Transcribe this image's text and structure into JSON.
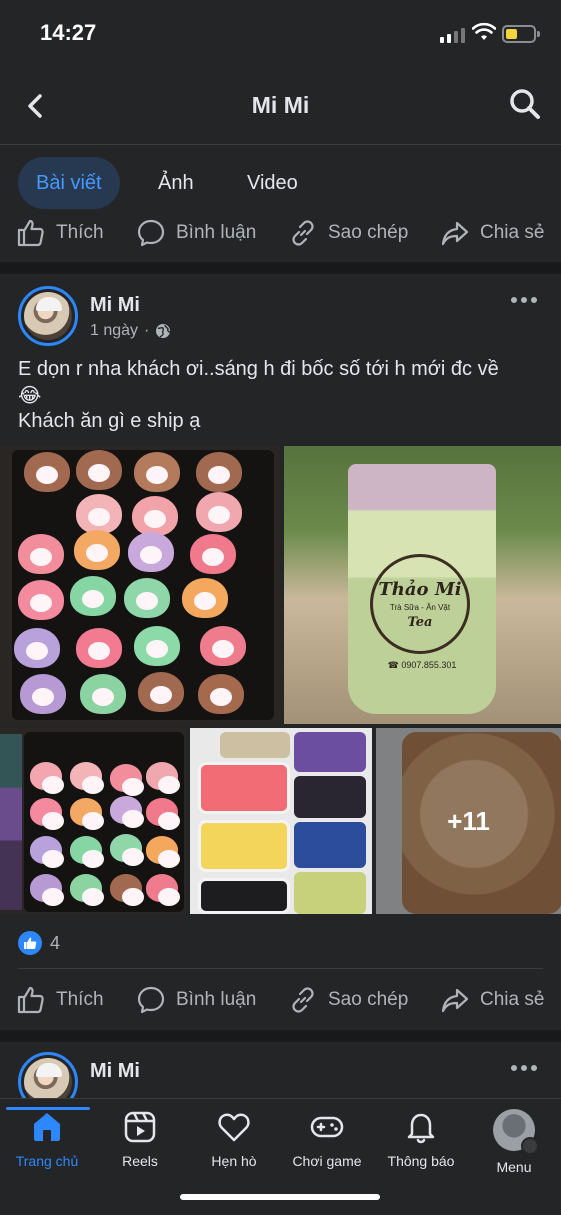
{
  "status": {
    "time": "14:27"
  },
  "header": {
    "title": "Mi Mi",
    "back_icon": "chevron-left-icon",
    "search_icon": "search-icon"
  },
  "tabs": [
    {
      "label": "Bài viết",
      "active": true
    },
    {
      "label": "Ảnh",
      "active": false
    },
    {
      "label": "Video",
      "active": false
    }
  ],
  "actions": {
    "like": "Thích",
    "comment": "Bình luận",
    "copy": "Sao chép",
    "share": "Chia sẻ"
  },
  "post": {
    "author": "Mi Mi",
    "time": "1 ngày",
    "privacy_icon": "globe-icon",
    "text_line1": "E dọn r nha khách ơi..sáng h đi bốc số tới h mới đc về",
    "emoji": "😂",
    "text_line2": "Khách ăn gì e ship ạ",
    "photos": {
      "cup_brand": "Thảo Mi",
      "cup_sub": "Trà Sữa - Ăn Vặt",
      "cup_tea": "Tea",
      "cup_phone": "☎ 0907.855.301",
      "more_count": "+11"
    },
    "reaction_count": "4"
  },
  "post2": {
    "author": "Mi Mi"
  },
  "bottom_nav": [
    {
      "label": "Trang chủ",
      "icon": "home-icon",
      "active": true
    },
    {
      "label": "Reels",
      "icon": "reels-icon",
      "active": false
    },
    {
      "label": "Hẹn hò",
      "icon": "heart-icon",
      "active": false
    },
    {
      "label": "Chơi game",
      "icon": "gamepad-icon",
      "active": false
    },
    {
      "label": "Thông báo",
      "icon": "bell-icon",
      "active": false
    },
    {
      "label": "Menu",
      "icon": "profile-avatar-icon",
      "active": false
    }
  ],
  "colors": {
    "accent": "#2d88ff",
    "background": "#242526",
    "text": "#e4e6eb",
    "muted": "#b0b3b8"
  }
}
